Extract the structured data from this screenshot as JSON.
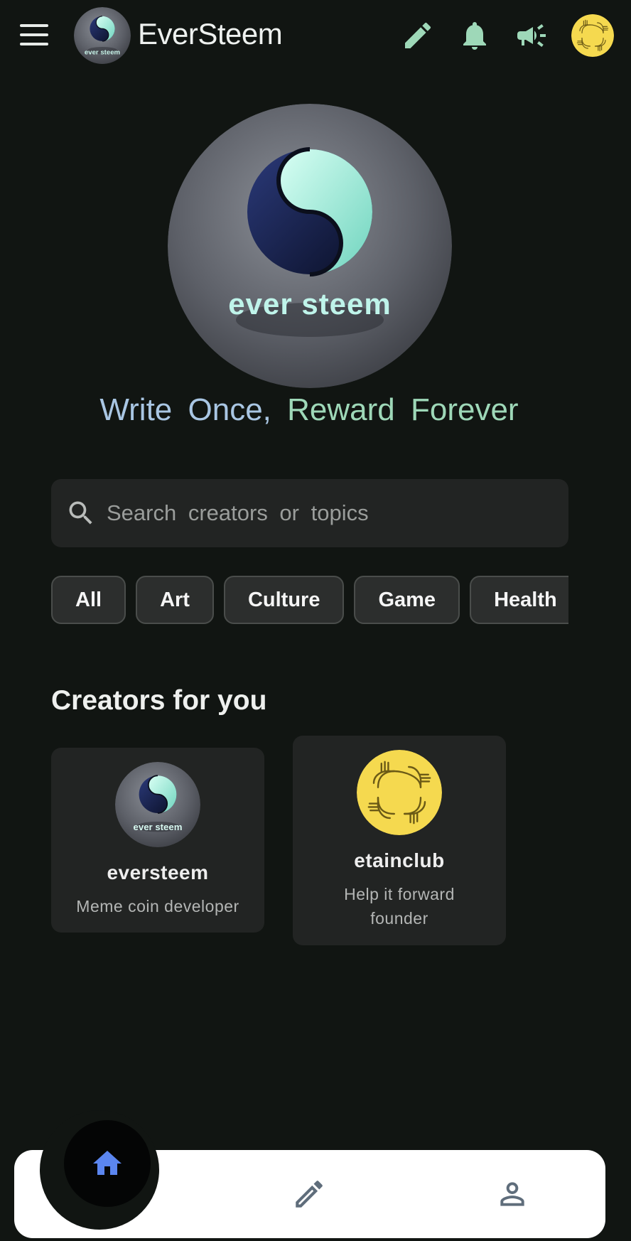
{
  "header": {
    "title": "EverSteem",
    "menu_icon": "hamburger-icon",
    "actions": [
      "pencil-icon",
      "bell-icon",
      "megaphone-icon",
      "user-avatar"
    ],
    "accent": "#9ed8b8"
  },
  "hero": {
    "logo_text": "ever steem",
    "tagline_part1": "Write Once,",
    "tagline_part2": "Reward Forever"
  },
  "search": {
    "placeholder": "Search creators or topics"
  },
  "categories": [
    "All",
    "Art",
    "Culture",
    "Game",
    "Health"
  ],
  "creators_section": {
    "title": "Creators for you",
    "creators": [
      {
        "name": "eversteem",
        "description": "Meme coin developer",
        "avatar_text": "ever steem"
      },
      {
        "name": "etainclub",
        "description": "Help it forward founder"
      }
    ]
  },
  "bottom_nav": {
    "items": [
      "home-icon",
      "pencil-icon",
      "profile-icon"
    ],
    "active": "home",
    "active_color": "#5b86f0"
  }
}
